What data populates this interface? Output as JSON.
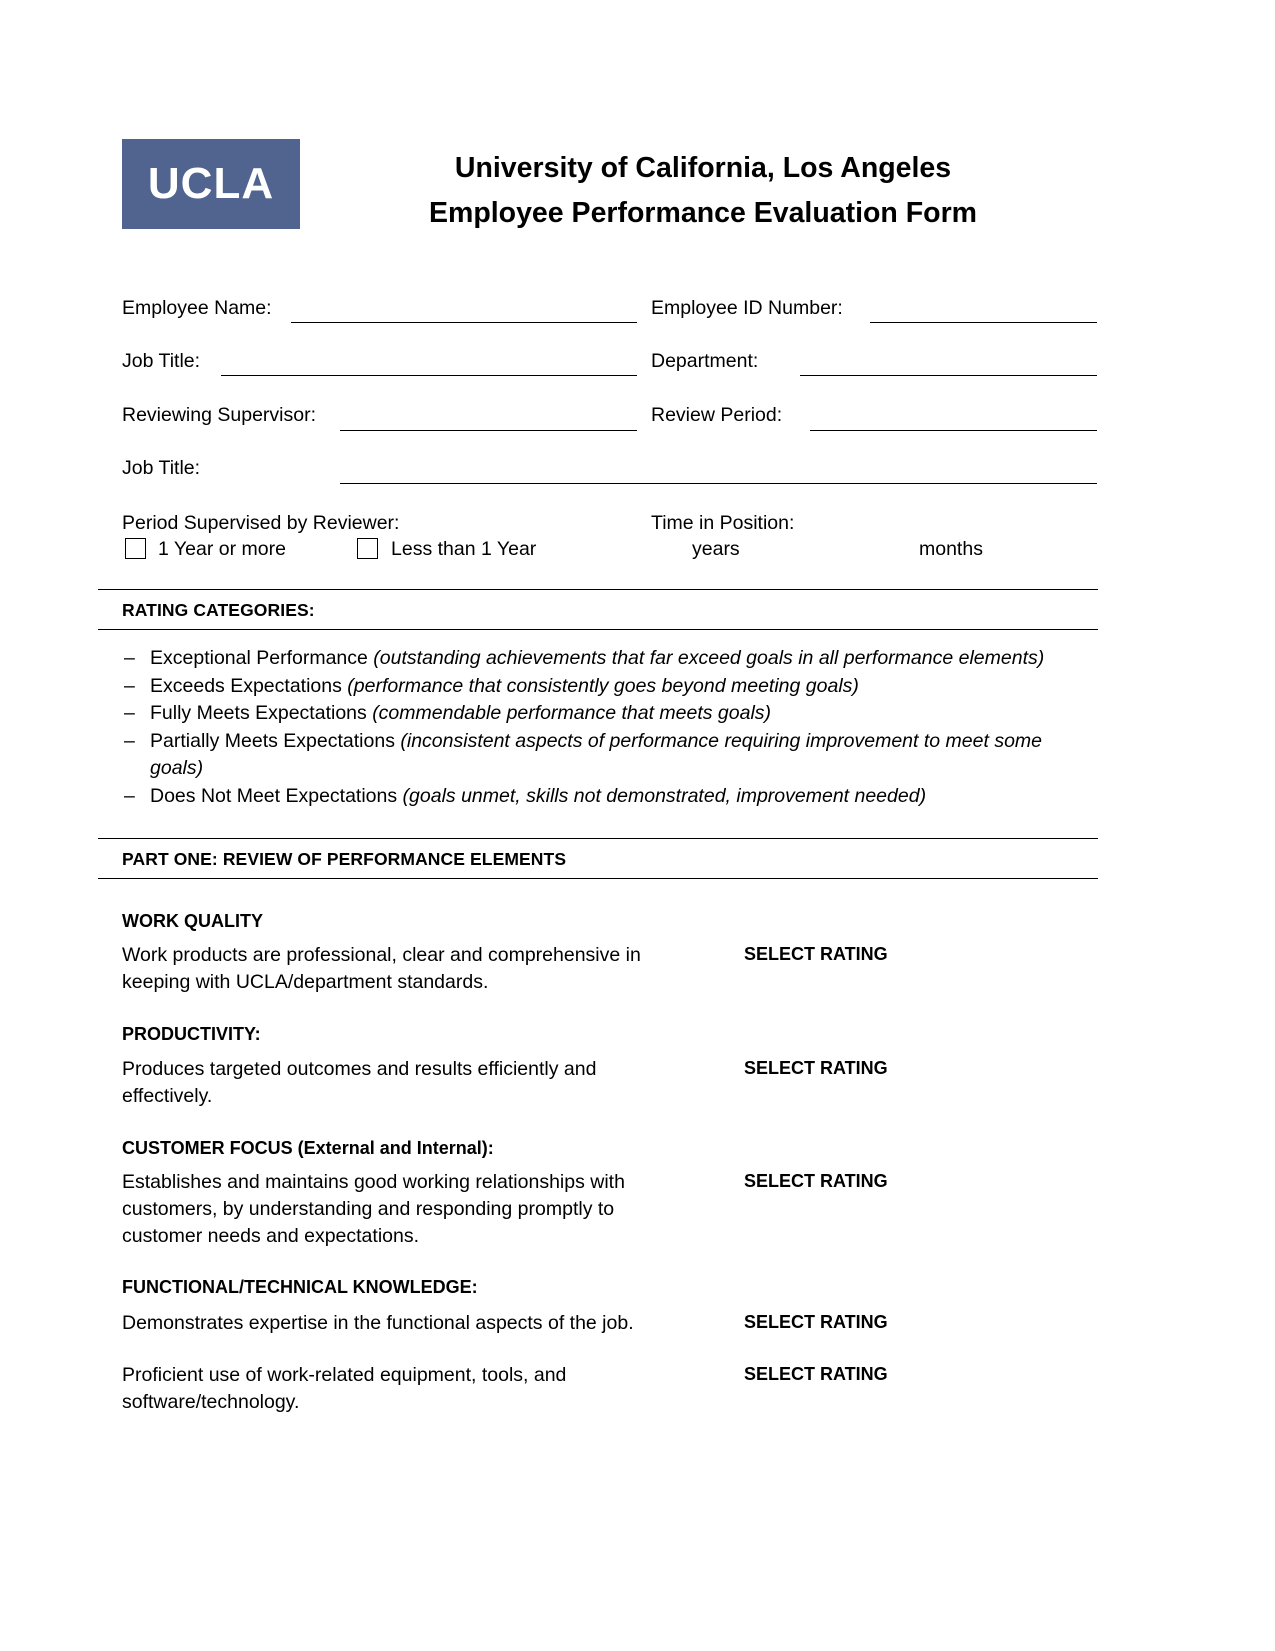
{
  "header": {
    "logo_text": "UCLA",
    "logo_color": "#51648F",
    "title_line1": "University of California, Los Angeles",
    "title_line2": "Employee Performance Evaluation Form"
  },
  "form_fields": {
    "employee_name_label": "Employee Name:",
    "employee_name_value": "",
    "employee_id_label": "Employee ID Number:",
    "employee_id_value": "",
    "job_title_label": "Job Title:",
    "job_title_value": "",
    "department_label": "Department:",
    "department_value": "",
    "reviewing_supervisor_label": "Reviewing Supervisor:",
    "reviewing_supervisor_value": "",
    "review_period_label": "Review Period:",
    "review_period_value": "",
    "supervisor_job_title_label": "Job Title:",
    "supervisor_job_title_value": "",
    "period_supervised_label": "Period Supervised by Reviewer:",
    "checkbox_1_label": "1 Year or more",
    "checkbox_1_checked": false,
    "checkbox_2_label": "Less than 1 Year",
    "checkbox_2_checked": false,
    "time_in_position_label": "Time in Position:",
    "years_label": "years",
    "years_value": "",
    "months_label": "months",
    "months_value": ""
  },
  "rating_categories": {
    "heading": "RATING CATEGORIES:",
    "items": [
      {
        "name": "Exceptional Performance",
        "desc": "(outstanding achievements that far exceed goals in all performance elements)"
      },
      {
        "name": "Exceeds Expectations",
        "desc": "(performance that consistently goes beyond meeting goals)"
      },
      {
        "name": "Fully Meets Expectations",
        "desc": "(commendable performance that meets goals)"
      },
      {
        "name": "Partially Meets Expectations",
        "desc": "(inconsistent aspects of performance requiring improvement to meet some goals)"
      },
      {
        "name": "Does Not Meet Expectations",
        "desc": "(goals unmet, skills not demonstrated, improvement needed)"
      }
    ]
  },
  "part_one": {
    "heading": "PART ONE: REVIEW OF PERFORMANCE ELEMENTS",
    "select_rating_label": "SELECT RATING",
    "elements": [
      {
        "heading": "WORK QUALITY",
        "desc": "Work products are professional, clear and comprehensive in keeping with UCLA/department standards.",
        "rating": "SELECT RATING"
      },
      {
        "heading": "PRODUCTIVITY:",
        "desc": "Produces targeted outcomes and results efficiently and effectively.",
        "rating": "SELECT RATING"
      },
      {
        "heading": "CUSTOMER FOCUS (External and Internal):",
        "desc": "Establishes and maintains good working relationships with customers, by understanding and responding promptly to customer needs and expectations.",
        "rating": "SELECT RATING"
      },
      {
        "heading": "FUNCTIONAL/TECHNICAL KNOWLEDGE:",
        "desc": "Demonstrates expertise in the functional aspects of the job.",
        "rating": "SELECT RATING"
      },
      {
        "heading": "",
        "desc": "Proficient use of work-related equipment, tools, and software/technology.",
        "rating": "SELECT RATING"
      }
    ]
  }
}
